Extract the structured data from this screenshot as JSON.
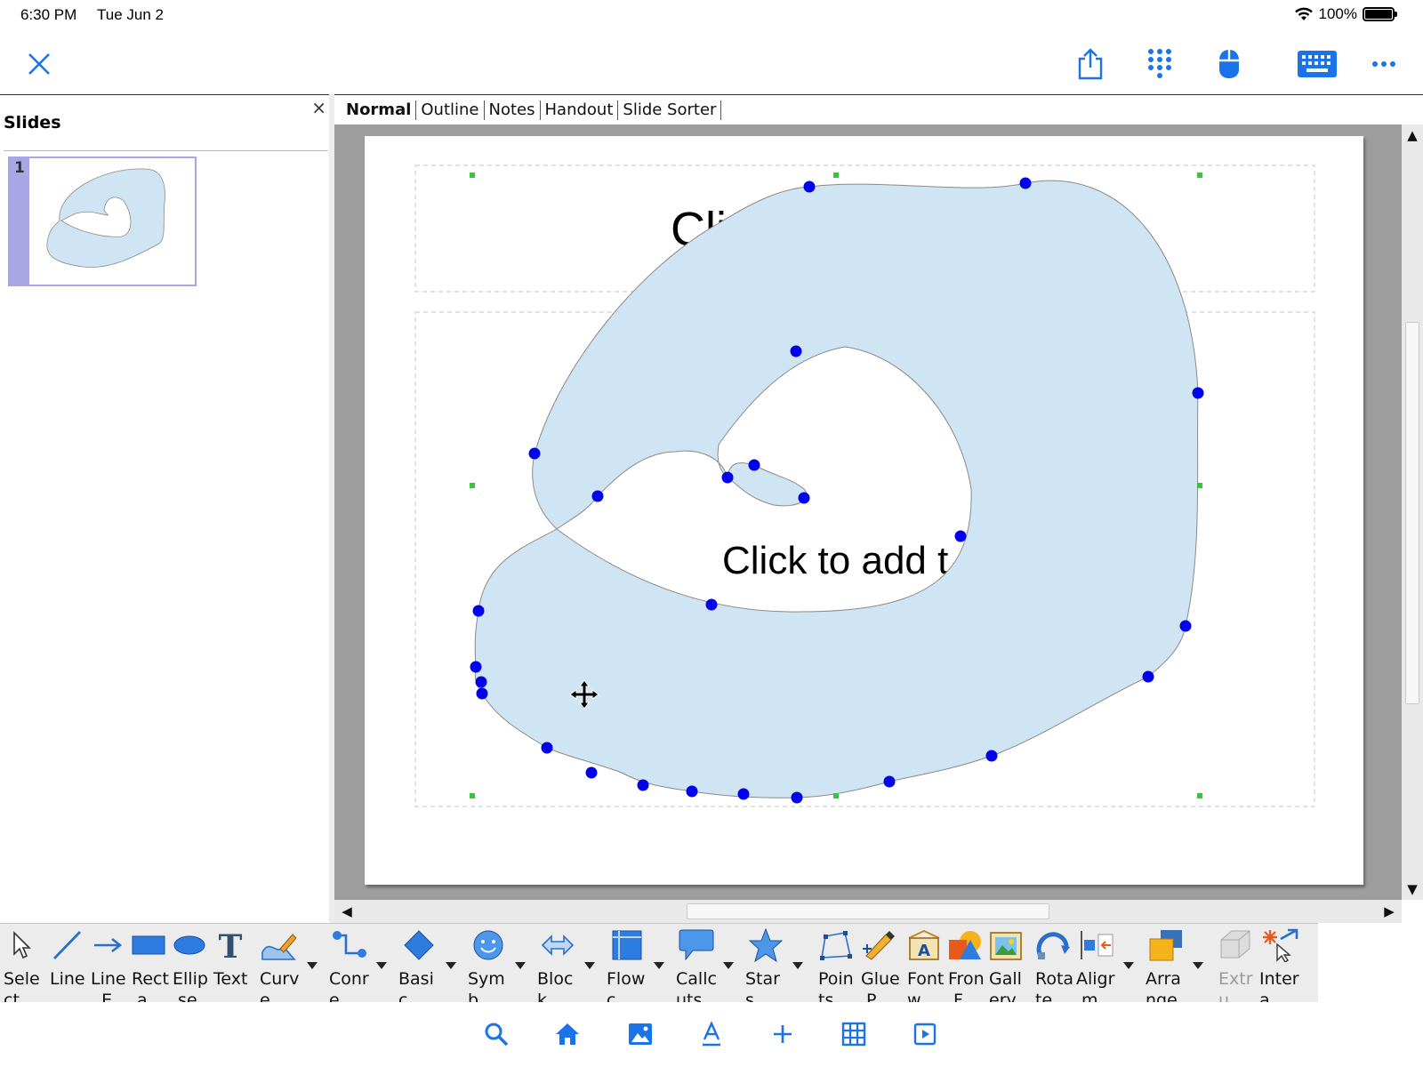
{
  "status_bar": {
    "time": "6:30 PM",
    "date": "Tue Jun 2",
    "battery": "100%",
    "icons": [
      "wifi-icon",
      "battery-icon"
    ]
  },
  "app_toolbar": {
    "left": [
      "close-icon"
    ],
    "right": [
      "share-icon",
      "dialpad-icon",
      "mouse-icon",
      "keyboard-icon",
      "more-icon"
    ],
    "accent": "#1a73e8"
  },
  "slides_panel": {
    "title": "Slides",
    "close": "×",
    "slides": [
      {
        "number": "1"
      }
    ]
  },
  "view_tabs": [
    {
      "label": "Normal",
      "active": true
    },
    {
      "label": "Outline",
      "active": false
    },
    {
      "label": "Notes",
      "active": false
    },
    {
      "label": "Handout",
      "active": false
    },
    {
      "label": "Slide Sorter",
      "active": false
    }
  ],
  "slide": {
    "title_placeholder_visible": "Cli",
    "content_placeholder_visible": "Click to add t",
    "shape_fill": "#d0e5f4",
    "point_color": "#0000ee",
    "handle_color": "#3ac43a"
  },
  "draw_tools": [
    {
      "id": "select",
      "label": "Sele\nct",
      "icon": "cursor-arrow-icon"
    },
    {
      "id": "line",
      "label": "Line",
      "icon": "line-icon"
    },
    {
      "id": "line-ends",
      "label": "Line\n  E...",
      "icon": "arrow-line-icon"
    },
    {
      "id": "rectangle",
      "label": "Rect\n a...",
      "icon": "rectangle-icon"
    },
    {
      "id": "ellipse",
      "label": "Ellip\n se",
      "icon": "ellipse-icon"
    },
    {
      "id": "text",
      "label": "Text",
      "icon": "text-t-icon"
    },
    {
      "id": "curve",
      "label": "Curv\ne",
      "icon": "curve-pencil-icon"
    },
    {
      "id": "connector",
      "label": "Conr\ne...",
      "icon": "connector-icon"
    },
    {
      "id": "basic-shapes",
      "label": "Basi\nc ...",
      "icon": "diamond-icon"
    },
    {
      "id": "symbol-shapes",
      "label": "Sym\nb...",
      "icon": "smiley-icon"
    },
    {
      "id": "block-arrows",
      "label": "Bloc\nk ...",
      "icon": "double-arrow-icon"
    },
    {
      "id": "flowchart",
      "label": "Flow\nc...",
      "icon": "flowchart-icon"
    },
    {
      "id": "callouts",
      "label": "Callc\nuts",
      "icon": "speech-bubble-icon"
    },
    {
      "id": "stars",
      "label": "Star\ns",
      "icon": "star-icon"
    },
    {
      "id": "points",
      "label": "Poin\nts",
      "icon": "points-icon"
    },
    {
      "id": "glue-points",
      "label": "Glue\n P...",
      "icon": "glue-pencil-icon"
    },
    {
      "id": "fontwork",
      "label": "Font\nw...",
      "icon": "fontwork-icon"
    },
    {
      "id": "from-file",
      "label": "Fron\n F...",
      "icon": "shapes-sun-icon"
    },
    {
      "id": "gallery",
      "label": "Gall\nery",
      "icon": "gallery-picture-icon"
    },
    {
      "id": "rotate",
      "label": "Rota\nte",
      "icon": "rotate-icon"
    },
    {
      "id": "align",
      "label": "Aligr\n m...",
      "icon": "align-icon"
    },
    {
      "id": "arrange",
      "label": "Arra\nnge",
      "icon": "arrange-icon"
    },
    {
      "id": "extrusion",
      "label": "Extr\nu...",
      "icon": "extrusion-icon",
      "disabled": true
    },
    {
      "id": "interaction",
      "label": "Inter\na...",
      "icon": "interaction-icon"
    }
  ],
  "bottom_bar": [
    "search-icon",
    "home-icon",
    "image-icon",
    "text-format-icon",
    "plus-icon",
    "table-icon",
    "slideshow-icon"
  ]
}
